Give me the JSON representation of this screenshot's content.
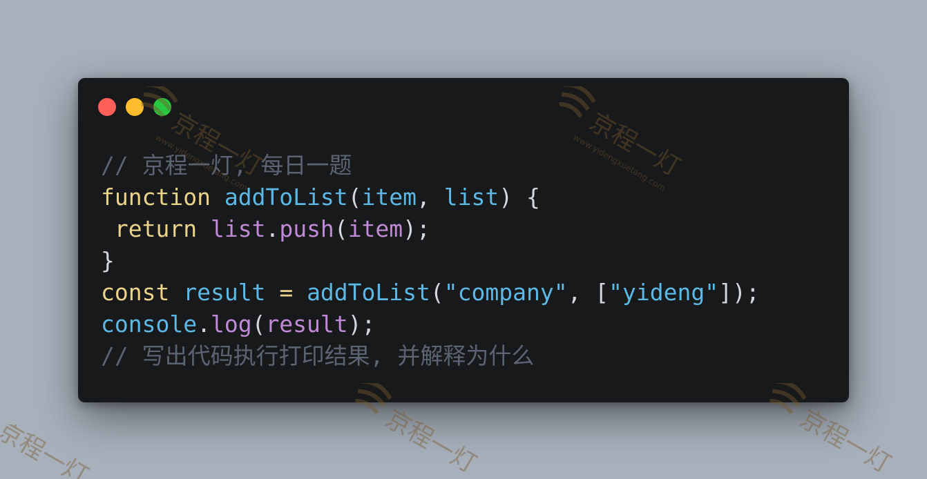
{
  "window": {
    "controls": {
      "close": "red-dot",
      "minimize": "yellow-dot",
      "maximize": "green-dot"
    }
  },
  "code": {
    "lines": [
      [
        {
          "t": "// 京程一灯, 每日一题",
          "k": "comment"
        }
      ],
      [
        {
          "t": "function",
          "k": "keyword"
        },
        {
          "t": " ",
          "k": "punct"
        },
        {
          "t": "addToList",
          "k": "fn"
        },
        {
          "t": "(",
          "k": "punct"
        },
        {
          "t": "item",
          "k": "param"
        },
        {
          "t": ", ",
          "k": "punct"
        },
        {
          "t": "list",
          "k": "param"
        },
        {
          "t": ") {",
          "k": "punct"
        }
      ],
      [
        {
          "t": " ",
          "k": "punct"
        },
        {
          "t": "return",
          "k": "keyword"
        },
        {
          "t": " ",
          "k": "punct"
        },
        {
          "t": "list",
          "k": "method"
        },
        {
          "t": ".",
          "k": "punct"
        },
        {
          "t": "push",
          "k": "method"
        },
        {
          "t": "(",
          "k": "punct"
        },
        {
          "t": "item",
          "k": "method"
        },
        {
          "t": ");",
          "k": "punct"
        }
      ],
      [
        {
          "t": "}",
          "k": "punct"
        }
      ],
      [
        {
          "t": "const",
          "k": "keyword"
        },
        {
          "t": " ",
          "k": "punct"
        },
        {
          "t": "result",
          "k": "var"
        },
        {
          "t": " ",
          "k": "punct"
        },
        {
          "t": "=",
          "k": "op"
        },
        {
          "t": " ",
          "k": "punct"
        },
        {
          "t": "addToList",
          "k": "fn"
        },
        {
          "t": "(",
          "k": "punct"
        },
        {
          "t": "\"company\"",
          "k": "string"
        },
        {
          "t": ", [",
          "k": "punct"
        },
        {
          "t": "\"yideng\"",
          "k": "string"
        },
        {
          "t": "]);",
          "k": "punct"
        }
      ],
      [
        {
          "t": "console",
          "k": "var"
        },
        {
          "t": ".",
          "k": "punct"
        },
        {
          "t": "log",
          "k": "method"
        },
        {
          "t": "(",
          "k": "punct"
        },
        {
          "t": "result",
          "k": "method"
        },
        {
          "t": ");",
          "k": "punct"
        }
      ],
      [
        {
          "t": "// 写出代码执行打印结果, 并解释为什么",
          "k": "comment"
        }
      ]
    ]
  },
  "watermark": {
    "brand": "京程一灯",
    "url": "www.yidengxuetang.com"
  },
  "colors": {
    "background": "#a7b0bb",
    "window": "#18191b",
    "comment": "#5b6473",
    "keyword": "#ebd38a",
    "identifier": "#5cb9e6",
    "method": "#c08ad6"
  }
}
